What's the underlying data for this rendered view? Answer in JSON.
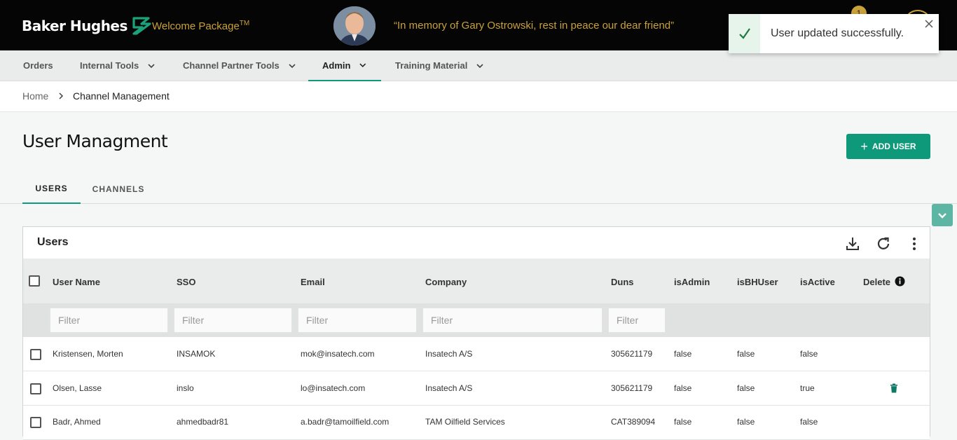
{
  "brand": {
    "name": "Baker Hughes",
    "welcome": "Welcome Package",
    "welcome_tm": "TM",
    "memorial": "“In memory of Gary Ostrowski, rest in peace our dear friend”",
    "notification_count": "1",
    "accent": "#c9a13a",
    "logo_color": "#1aa37a"
  },
  "toast": {
    "message": "User updated successfully.",
    "icon": "check-icon",
    "close_icon": "close-icon"
  },
  "nav": {
    "items": [
      {
        "label": "Orders"
      },
      {
        "label": "Internal Tools"
      },
      {
        "label": "Channel Partner Tools"
      },
      {
        "label": "Admin"
      },
      {
        "label": "Training Material"
      }
    ],
    "active": "Admin"
  },
  "breadcrumb": {
    "home": "Home",
    "current": "Channel Management"
  },
  "page": {
    "title": "User Managment",
    "add_button": "ADD USER",
    "add_icon": "+"
  },
  "tabs": {
    "users": "USERS",
    "channels": "CHANNELS",
    "active": "USERS"
  },
  "users_card": {
    "title": "Users",
    "toolbar_icons": [
      "download-icon",
      "refresh-icon",
      "more-vertical-icon"
    ],
    "columns": {
      "user_name": "User Name",
      "sso": "SSO",
      "email": "Email",
      "company": "Company",
      "duns": "Duns",
      "is_admin": "isAdmin",
      "is_bh_user": "isBHUser",
      "is_active": "isActive",
      "delete": "Delete"
    },
    "filter_placeholder": "Filter",
    "rows": [
      {
        "name": "Kristensen, Morten",
        "sso": "INSAMOK",
        "email": "mok@insatech.com",
        "company": "Insatech A/S",
        "duns": "305621179",
        "is_admin": "false",
        "is_bh_user": "false",
        "is_active": "false",
        "deletable": false
      },
      {
        "name": "Olsen, Lasse",
        "sso": "inslo",
        "email": "lo@insatech.com",
        "company": "Insatech A/S",
        "duns": "305621179",
        "is_admin": "false",
        "is_bh_user": "false",
        "is_active": "true",
        "deletable": true
      },
      {
        "name": "Badr, Ahmed",
        "sso": "ahmedbadr81",
        "email": "a.badr@tamoilfield.com",
        "company": "TAM Oilfield Services",
        "duns": "CAT389094",
        "is_admin": "false",
        "is_bh_user": "false",
        "is_active": "false",
        "deletable": false
      }
    ]
  },
  "colors": {
    "primary": "#0e9a7a",
    "header_bg": "#050505",
    "toast_success_bg": "#e6f4ec"
  }
}
